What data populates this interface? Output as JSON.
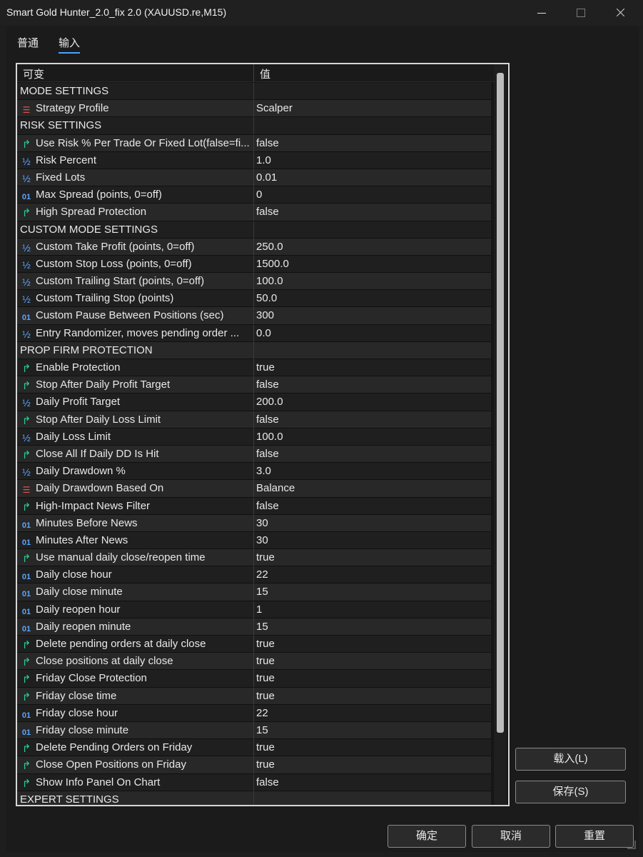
{
  "window": {
    "title": "Smart Gold Hunter_2.0_fix 2.0 (XAUUSD.re,M15)"
  },
  "tabs": [
    {
      "label": "普通"
    },
    {
      "label": "输入"
    }
  ],
  "table": {
    "headers": [
      "可变",
      "值"
    ],
    "rows": [
      {
        "type": "section",
        "name": "MODE SETTINGS",
        "value": ""
      },
      {
        "type": "enum",
        "icon": "list-enum-icon",
        "name": "Strategy Profile",
        "value": "Scalper"
      },
      {
        "type": "section",
        "name": "RISK SETTINGS",
        "value": ""
      },
      {
        "type": "bool",
        "icon": "bool-arrow-icon",
        "name": "Use Risk % Per Trade Or Fixed Lot(false=fi...",
        "value": "false"
      },
      {
        "type": "double",
        "icon": "fraction-icon",
        "name": "Risk Percent",
        "value": "1.0"
      },
      {
        "type": "double",
        "icon": "fraction-icon",
        "name": "Fixed Lots",
        "value": "0.01"
      },
      {
        "type": "int",
        "icon": "integer-icon",
        "name": "Max Spread (points, 0=off)",
        "value": "0"
      },
      {
        "type": "bool",
        "icon": "bool-arrow-icon",
        "name": "High Spread Protection",
        "value": "false"
      },
      {
        "type": "section",
        "name": "CUSTOM MODE SETTINGS",
        "value": ""
      },
      {
        "type": "double",
        "icon": "fraction-icon",
        "name": "Custom Take Profit (points, 0=off)",
        "value": "250.0"
      },
      {
        "type": "double",
        "icon": "fraction-icon",
        "name": "Custom Stop Loss (points, 0=off)",
        "value": "1500.0"
      },
      {
        "type": "double",
        "icon": "fraction-icon",
        "name": "Custom Trailing Start (points, 0=off)",
        "value": "100.0"
      },
      {
        "type": "double",
        "icon": "fraction-icon",
        "name": "Custom Trailing Stop (points)",
        "value": "50.0"
      },
      {
        "type": "int",
        "icon": "integer-icon",
        "name": "Custom Pause Between Positions (sec)",
        "value": "300"
      },
      {
        "type": "double",
        "icon": "fraction-icon",
        "name": "Entry Randomizer, moves pending order ...",
        "value": "0.0"
      },
      {
        "type": "section",
        "name": "PROP FIRM PROTECTION",
        "value": ""
      },
      {
        "type": "bool",
        "icon": "bool-arrow-icon",
        "name": "Enable Protection",
        "value": "true"
      },
      {
        "type": "bool",
        "icon": "bool-arrow-icon",
        "name": "Stop After Daily Profit Target",
        "value": "false"
      },
      {
        "type": "double",
        "icon": "fraction-icon",
        "name": "Daily Profit Target",
        "value": "200.0"
      },
      {
        "type": "bool",
        "icon": "bool-arrow-icon",
        "name": "Stop After Daily Loss Limit",
        "value": "false"
      },
      {
        "type": "double",
        "icon": "fraction-icon",
        "name": "Daily Loss Limit",
        "value": "100.0"
      },
      {
        "type": "bool",
        "icon": "bool-arrow-icon",
        "name": "Close All If Daily DD Is Hit",
        "value": "false"
      },
      {
        "type": "double",
        "icon": "fraction-icon",
        "name": "Daily Drawdown %",
        "value": "3.0"
      },
      {
        "type": "enum",
        "icon": "list-enum-icon",
        "name": "Daily Drawdown Based On",
        "value": "Balance"
      },
      {
        "type": "bool",
        "icon": "bool-arrow-icon",
        "name": "High-Impact News Filter",
        "value": "false"
      },
      {
        "type": "int",
        "icon": "integer-icon",
        "name": "Minutes Before News",
        "value": "30"
      },
      {
        "type": "int",
        "icon": "integer-icon",
        "name": "Minutes After News",
        "value": "30"
      },
      {
        "type": "bool",
        "icon": "bool-arrow-icon",
        "name": "Use manual daily close/reopen time",
        "value": "true"
      },
      {
        "type": "int",
        "icon": "integer-icon",
        "name": "Daily close hour",
        "value": "22"
      },
      {
        "type": "int",
        "icon": "integer-icon",
        "name": "Daily close minute",
        "value": "15"
      },
      {
        "type": "int",
        "icon": "integer-icon",
        "name": "Daily reopen hour",
        "value": "1"
      },
      {
        "type": "int",
        "icon": "integer-icon",
        "name": "Daily reopen minute",
        "value": "15"
      },
      {
        "type": "bool",
        "icon": "bool-arrow-icon",
        "name": "Delete pending orders at daily close",
        "value": "true"
      },
      {
        "type": "bool",
        "icon": "bool-arrow-icon",
        "name": "Close positions at daily close",
        "value": "true"
      },
      {
        "type": "bool",
        "icon": "bool-arrow-icon",
        "name": "Friday Close Protection",
        "value": "true"
      },
      {
        "type": "bool",
        "icon": "bool-arrow-icon",
        "name": "Friday close time",
        "value": "true"
      },
      {
        "type": "int",
        "icon": "integer-icon",
        "name": "Friday close hour",
        "value": "22"
      },
      {
        "type": "int",
        "icon": "integer-icon",
        "name": "Friday close minute",
        "value": "15"
      },
      {
        "type": "bool",
        "icon": "bool-arrow-icon",
        "name": "Delete Pending Orders on Friday",
        "value": "true"
      },
      {
        "type": "bool",
        "icon": "bool-arrow-icon",
        "name": "Close Open Positions on Friday",
        "value": "true"
      },
      {
        "type": "bool",
        "icon": "bool-arrow-icon",
        "name": "Show Info Panel On Chart",
        "value": "false"
      },
      {
        "type": "section",
        "name": "EXPERT SETTINGS",
        "value": ""
      }
    ]
  },
  "buttons": {
    "load": "载入(L)",
    "save": "保存(S)",
    "ok": "确定",
    "cancel": "取消",
    "reset": "重置"
  }
}
